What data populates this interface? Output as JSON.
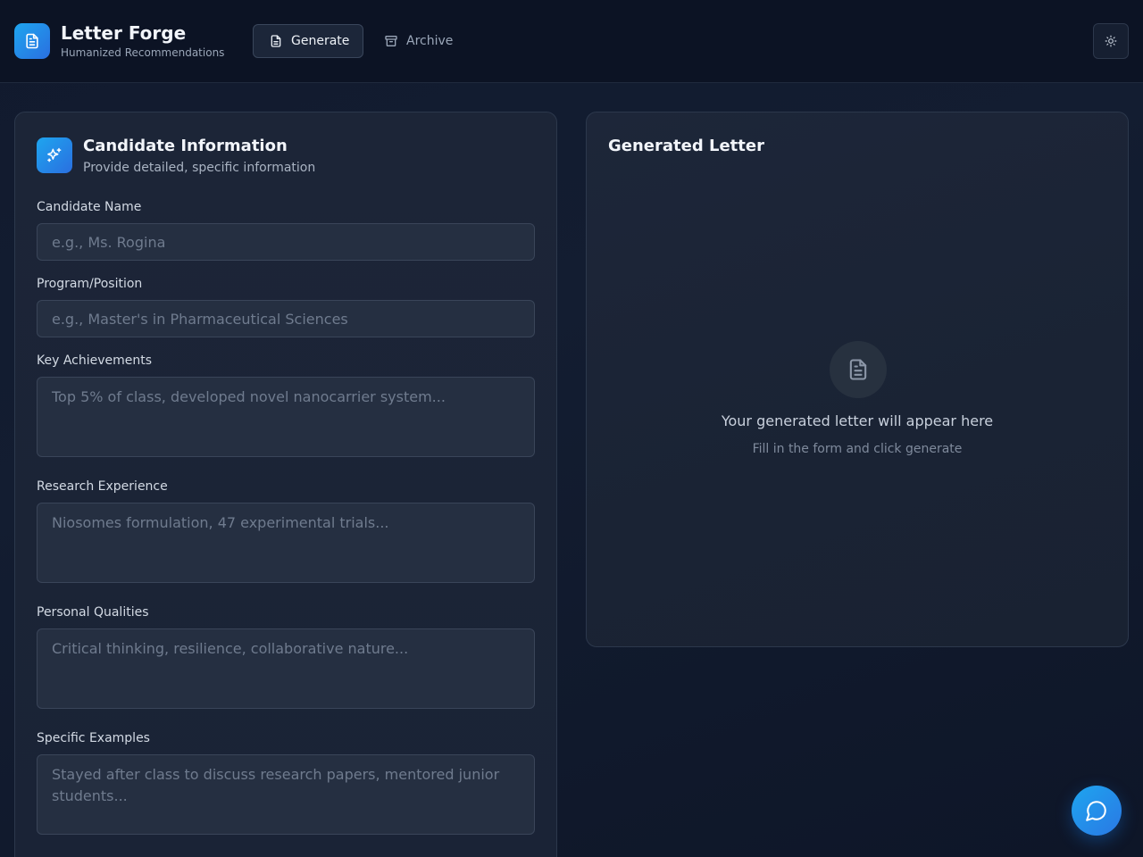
{
  "header": {
    "brand_title": "Letter Forge",
    "brand_subtitle": "Humanized Recommendations",
    "logo_icon": "document-icon",
    "nav": {
      "generate_label": "Generate",
      "archive_label": "Archive",
      "active": "Generate"
    },
    "theme_toggle_icon": "sun-icon"
  },
  "form": {
    "title": "Candidate Information",
    "subtitle": "Provide detailed, specific information",
    "icon": "sparkles-icon",
    "fields": {
      "candidate_name": {
        "label": "Candidate Name",
        "placeholder": "e.g., Ms. Rogina",
        "value": ""
      },
      "program_position": {
        "label": "Program/Position",
        "placeholder": "e.g., Master's in Pharmaceutical Sciences",
        "value": ""
      },
      "key_achievements": {
        "label": "Key Achievements",
        "placeholder": "Top 5% of class, developed novel nanocarrier system...",
        "value": ""
      },
      "research_experience": {
        "label": "Research Experience",
        "placeholder": "Niosomes formulation, 47 experimental trials...",
        "value": ""
      },
      "personal_qualities": {
        "label": "Personal Qualities",
        "placeholder": "Critical thinking, resilience, collaborative nature...",
        "value": ""
      },
      "specific_examples": {
        "label": "Specific Examples",
        "placeholder": "Stayed after class to discuss research papers, mentored junior students...",
        "value": ""
      }
    }
  },
  "output": {
    "title": "Generated Letter",
    "empty_icon": "document-icon",
    "empty_title": "Your generated letter will appear here",
    "empty_subtitle": "Fill in the form and click generate"
  },
  "chat_button_icon": "chat-bubble-icon",
  "colors": {
    "accent": "#1ea5ef",
    "accent_dark": "#2a6fe0",
    "background": "#0f1729",
    "card": "#1c2537",
    "input": "#252f41"
  }
}
